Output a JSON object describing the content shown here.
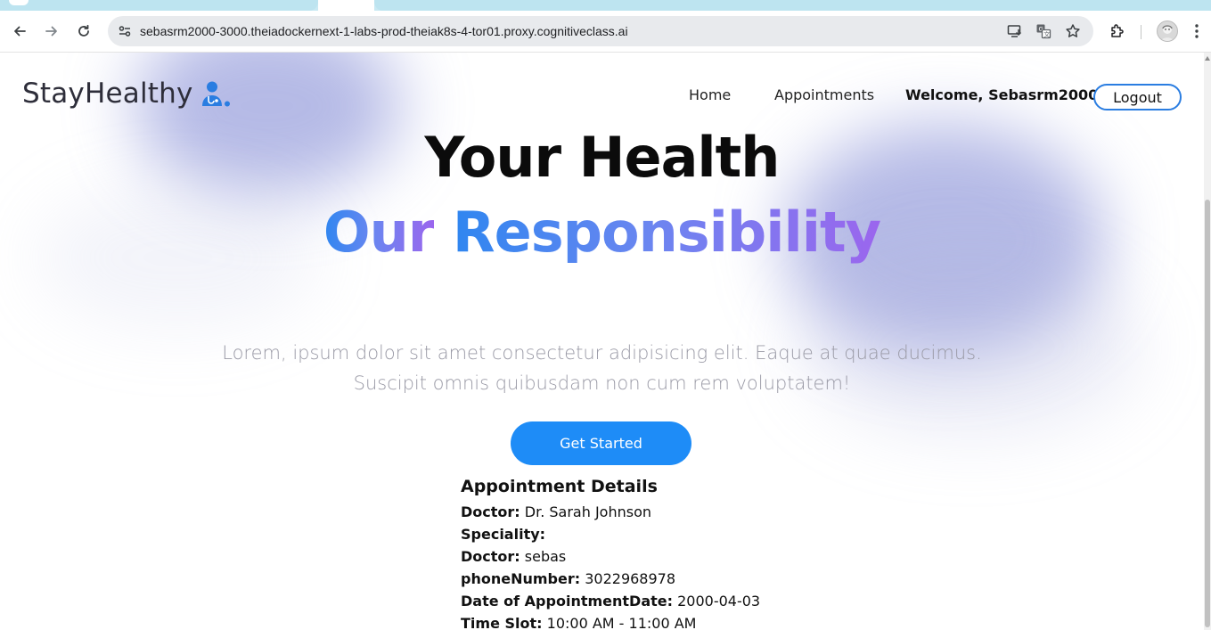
{
  "browser": {
    "url": "sebasrm2000-3000.theiadockernext-1-labs-prod-theiak8s-4-tor01.proxy.cognitiveclass.ai",
    "icons": [
      "back-icon",
      "forward-icon",
      "reload-icon",
      "site-info-icon",
      "install-app-icon",
      "translate-icon",
      "bookmark-star-icon",
      "extensions-icon",
      "profile-avatar",
      "menu-kebab-icon"
    ]
  },
  "header": {
    "brand": "StayHealthy",
    "nav": {
      "home": "Home",
      "appointments": "Appointments"
    },
    "welcome": "Welcome, Sebasrm2000",
    "logout": "Logout"
  },
  "hero": {
    "line1": "Your Health",
    "line2_word1": "Our",
    "line2_word2": "Responsibility",
    "description_line1": "Lorem, ipsum dolor sit amet consectetur adipisicing elit. Eaque at quae ducimus.",
    "description_line2": "Suscipit omnis quibusdam non cum rem voluptatem!",
    "cta": "Get Started"
  },
  "appointment": {
    "title": "Appointment Details",
    "rows": [
      {
        "label": "Doctor:",
        "value": "Dr. Sarah Johnson"
      },
      {
        "label": "Speciality:",
        "value": ""
      },
      {
        "label": "Doctor:",
        "value": "sebas"
      },
      {
        "label": "phoneNumber:",
        "value": "3022968978"
      },
      {
        "label": "Date of AppointmentDate:",
        "value": "2000-04-03"
      },
      {
        "label": "Time Slot:",
        "value": "10:00 AM - 11:00 AM"
      }
    ]
  },
  "colors": {
    "accent": "#1e8cf7",
    "gradient_start": "#2f86f0",
    "gradient_end": "#9b66ee",
    "logout_border": "#2a7de1"
  }
}
